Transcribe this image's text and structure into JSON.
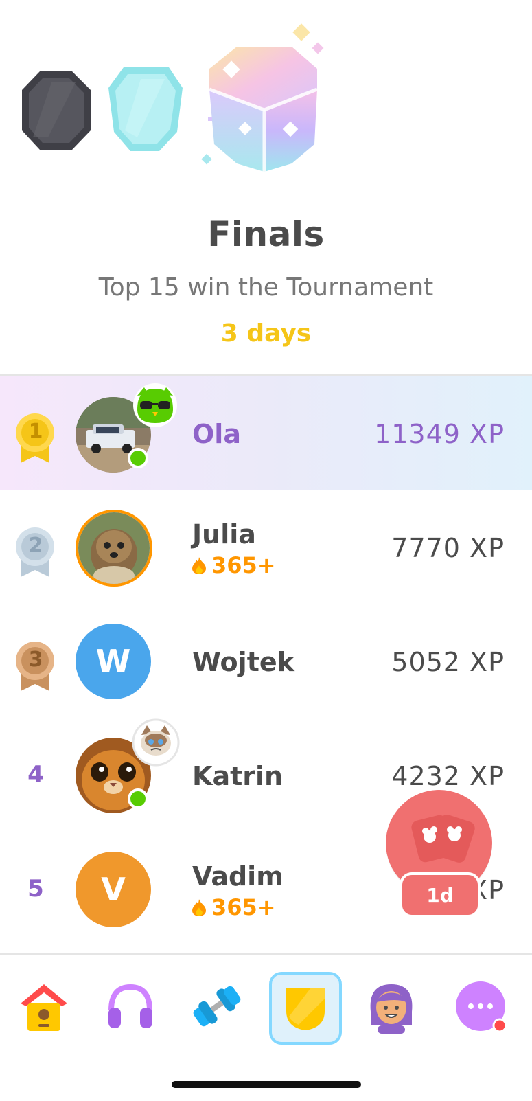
{
  "header": {
    "league_title": "Finals",
    "subtitle": "Top 15 win the Tournament",
    "time_left": "3 days"
  },
  "leaderboard": [
    {
      "rank": "1",
      "name": "Ola",
      "xp": "11349 XP",
      "streak": "",
      "online": true,
      "highlighted": true
    },
    {
      "rank": "2",
      "name": "Julia",
      "xp": "7770 XP",
      "streak": "365+",
      "online": false,
      "highlighted": false
    },
    {
      "rank": "3",
      "name": "Wojtek",
      "xp": "5052 XP",
      "streak": "",
      "online": false,
      "avatar_letter": "W",
      "highlighted": false
    },
    {
      "rank": "4",
      "name": "Katrin",
      "xp": "4232 XP",
      "streak": "",
      "online": true,
      "highlighted": false
    },
    {
      "rank": "5",
      "name": "Vadim",
      "xp": "5… XP",
      "streak": "365+",
      "online": false,
      "avatar_letter": "V",
      "highlighted": false
    }
  ],
  "friend_quest": {
    "badge": "1d"
  },
  "tabs": [
    {
      "icon": "home-icon"
    },
    {
      "icon": "headphones-icon"
    },
    {
      "icon": "dumbbell-icon"
    },
    {
      "icon": "shield-icon",
      "active": true
    },
    {
      "icon": "profile-icon"
    },
    {
      "icon": "more-icon"
    }
  ],
  "colors": {
    "purple": "#8e62c8",
    "gold": "#f5c518",
    "streak": "#ff9600",
    "online": "#58cc02",
    "fab": "#f07070"
  }
}
